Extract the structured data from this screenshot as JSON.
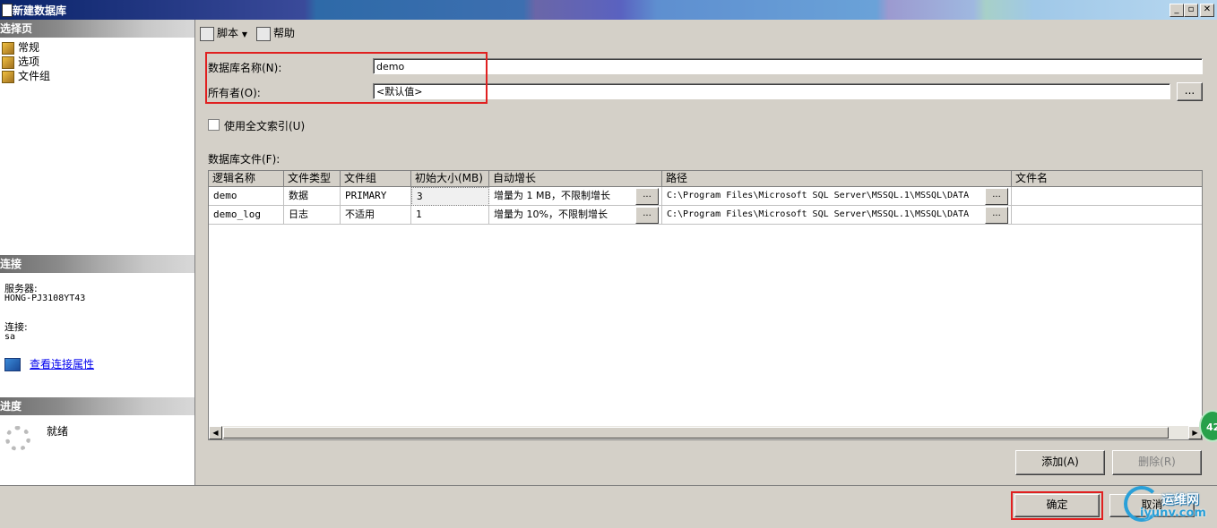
{
  "window": {
    "title": "新建数据库"
  },
  "left_pane": {
    "select_page_header": "选择页",
    "pages": [
      {
        "label": "常规",
        "icon": "page-wrench-icon"
      },
      {
        "label": "选项",
        "icon": "page-wrench-icon"
      },
      {
        "label": "文件组",
        "icon": "page-wrench-icon"
      }
    ],
    "connection_header": "连接",
    "server_label": "服务器:",
    "server_value": "HONG-PJ3108YT43",
    "connection_label": "连接:",
    "connection_value": "sa",
    "view_connection_link": "查看连接属性",
    "progress_header": "进度",
    "progress_status": "就绪"
  },
  "toolbar": {
    "script_label": "脚本",
    "help_label": "帮助"
  },
  "form": {
    "db_name_label": "数据库名称(N):",
    "db_name_value": "demo",
    "owner_label": "所有者(O):",
    "owner_value": "<默认值>",
    "browse_label": "...",
    "fulltext_label": "使用全文索引(U)",
    "files_label": "数据库文件(F):"
  },
  "grid": {
    "columns": [
      "逻辑名称",
      "文件类型",
      "文件组",
      "初始大小(MB)",
      "自动增长",
      "路径",
      "文件名"
    ],
    "rows": [
      {
        "logical": "demo",
        "type": "数据",
        "group": "PRIMARY",
        "size": "3",
        "growth": "增量为 1 MB，不限制增长",
        "path": "C:\\Program Files\\Microsoft SQL Server\\MSSQL.1\\MSSQL\\DATA",
        "file": ""
      },
      {
        "logical": "demo_log",
        "type": "日志",
        "group": "不适用",
        "size": "1",
        "growth": "增量为 10%，不限制增长",
        "path": "C:\\Program Files\\Microsoft SQL Server\\MSSQL.1\\MSSQL\\DATA",
        "file": ""
      }
    ]
  },
  "buttons": {
    "add": "添加(A)",
    "remove": "删除(R)",
    "ok": "确定",
    "cancel": "取消"
  },
  "watermark": {
    "badge": "42",
    "site_cn": "运维网",
    "site_en": "iyunv.com"
  }
}
